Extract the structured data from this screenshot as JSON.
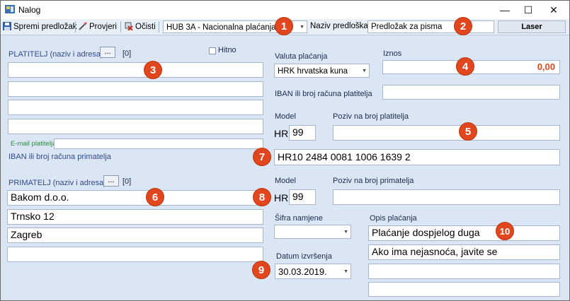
{
  "window": {
    "title": "Nalog",
    "minimize": "—",
    "maximize": "☐",
    "close": "✕"
  },
  "toolbar": {
    "save_label": "Spremi predložak",
    "check_label": "Provjeri",
    "clear_label": "Očisti",
    "template_type": "HUB 3A - Nacionalna plaćanja",
    "template_name_label": "Naziv predloška",
    "template_name_value": "Predložak za pisma",
    "laser_label": "Laser"
  },
  "payer": {
    "title": "PLATITELJ (naziv i adresa)",
    "dots": "...",
    "count": "[0]",
    "urgent_label": "Hitno",
    "lines": [
      "",
      "",
      "",
      ""
    ],
    "email_label": "E-mail platitelja",
    "email_value": "",
    "recipient_iban_label": "IBAN ili broj računa primatelja"
  },
  "recipient": {
    "title": "PRIMATELJ (naziv i adresa)",
    "dots": "...",
    "count": "[0]",
    "lines": [
      "Bakom d.o.o.",
      "Trnsko 12",
      "Zagreb",
      ""
    ]
  },
  "payment": {
    "currency_label": "Valuta plaćanja",
    "currency_value": "HRK hrvatska kuna",
    "amount_label": "Iznos",
    "amount_value": "0,00",
    "payer_iban_label": "IBAN ili broj računa platitelja",
    "payer_iban_value": "",
    "model_label": "Model",
    "model_prefix": "HR",
    "payer_model": "99",
    "payer_ref_label": "Poziv na broj platitelja",
    "payer_ref_value": "",
    "recipient_iban_value": "HR10 2484 0081 1006 1639 2",
    "recipient_model_label": "Model",
    "recipient_model_prefix": "HR",
    "recipient_model": "99",
    "recipient_ref_label": "Poziv na broj primatelja",
    "recipient_ref_value": "",
    "purpose_label": "Šifra namjene",
    "purpose_value": "",
    "description_label": "Opis plaćanja",
    "description_lines": [
      "Plaćanje dospjelog duga",
      "Ako ima nejasnoća, javite se",
      "",
      ""
    ],
    "date_label": "Datum izvršenja",
    "date_value": "30.03.2019."
  },
  "badges": [
    "1",
    "2",
    "3",
    "4",
    "5",
    "6",
    "7",
    "8",
    "9",
    "10"
  ],
  "colors": {
    "badge": "#e2461e",
    "amount": "#e2461e",
    "email_label": "#2d8a3a"
  }
}
